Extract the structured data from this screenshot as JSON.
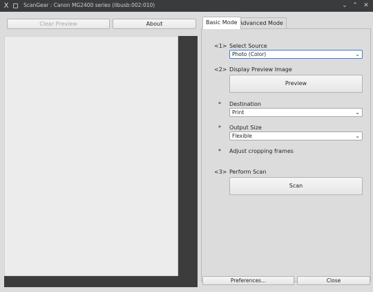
{
  "window": {
    "title": "ScanGear : Canon MG2400 series (libusb:002:010)",
    "app_icon_glyph": "X",
    "minimize_glyph": "⌄",
    "maximize_glyph": "⌃",
    "close_glyph": "✕"
  },
  "left_pane": {
    "clear_preview_label": "Clear Preview",
    "about_label": "About"
  },
  "tabs": [
    {
      "label": "Basic Mode",
      "active": true
    },
    {
      "label": "Advanced Mode",
      "active": false
    }
  ],
  "basic_mode": {
    "step1": {
      "marker": "<1>",
      "label": "Select Source",
      "value": "Photo (Color)"
    },
    "step2": {
      "marker": "<2>",
      "label": "Display Preview Image",
      "button": "Preview"
    },
    "destination": {
      "marker": "*",
      "label": "Destination",
      "value": "Print"
    },
    "output_size": {
      "marker": "*",
      "label": "Output Size",
      "value": "Flexible"
    },
    "cropping": {
      "marker": "*",
      "label": "Adjust cropping frames"
    },
    "step3": {
      "marker": "<3>",
      "label": "Perform Scan",
      "button": "Scan"
    }
  },
  "footer": {
    "preferences_label": "Preferences...",
    "close_label": "Close"
  },
  "colors": {
    "titlebar": "#3a3b3d",
    "window_bg": "#dcdcdc",
    "preview_dark": "#3c3c3c",
    "focus_border": "#3e7ad6"
  }
}
